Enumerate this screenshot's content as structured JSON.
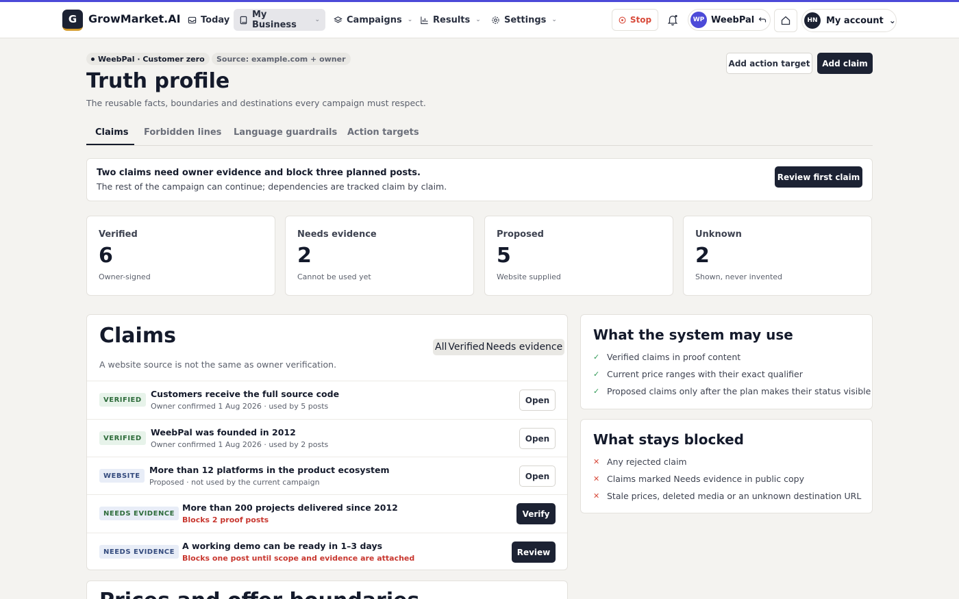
{
  "app": {
    "logo_letter": "G",
    "brand": "GrowMarket.AI"
  },
  "nav": {
    "today": "Today",
    "my_business": "My Business",
    "campaigns": "Campaigns",
    "results": "Results",
    "settings": "Settings"
  },
  "header_actions": {
    "stop": "Stop",
    "workspace_initials": "WP",
    "workspace_name": "WeebPal",
    "account_initials": "HN",
    "account_label": "My account"
  },
  "page": {
    "pill_business": "WeebPal · Customer zero",
    "pill_source": "Source: example.com + owner",
    "title": "Truth profile",
    "subtitle": "The reusable facts, boundaries and destinations every campaign must respect.",
    "add_action_target": "Add action target",
    "add_claim": "Add claim"
  },
  "tabs": [
    "Claims",
    "Forbidden lines",
    "Language guardrails",
    "Action targets"
  ],
  "alert": {
    "title": "Two claims need owner evidence and block three planned posts.",
    "subtitle": "The rest of the campaign can continue; dependencies are tracked claim by claim.",
    "button": "Review first claim"
  },
  "stats": [
    {
      "label": "Verified",
      "value": "6",
      "caption": "Owner-signed"
    },
    {
      "label": "Needs evidence",
      "value": "2",
      "caption": "Cannot be used yet"
    },
    {
      "label": "Proposed",
      "value": "5",
      "caption": "Website supplied"
    },
    {
      "label": "Unknown",
      "value": "2",
      "caption": "Shown, never invented"
    }
  ],
  "claims": {
    "title": "Claims",
    "subtitle": "A website source is not the same as owner verification.",
    "filters": [
      "All",
      "Verified",
      "Needs evidence"
    ],
    "rows": [
      {
        "badge": "VERIFIED",
        "title": "Customers receive the full source code",
        "meta": "Owner confirmed 1 Aug 2026 · used by 5 posts",
        "action": "Open"
      },
      {
        "badge": "VERIFIED",
        "title": "WeebPal was founded in 2012",
        "meta": "Owner confirmed 1 Aug 2026 · used by 2 posts",
        "action": "Open"
      },
      {
        "badge": "WEBSITE",
        "title": "More than 12 platforms in the product ecosystem",
        "meta": "Proposed · not used by the current campaign",
        "action": "Open"
      },
      {
        "badge": "NEEDS EVIDENCE",
        "title": "More than 200 projects delivered since 2012",
        "meta": "Blocks 2 proof posts",
        "action": "Verify"
      },
      {
        "badge": "NEEDS EVIDENCE",
        "title": "A working demo can be ready in 1–3 days",
        "meta": "Blocks one post until scope and evidence are attached",
        "action": "Review"
      }
    ]
  },
  "may_use": {
    "title": "What the system may use",
    "items": [
      "Verified claims in proof content",
      "Current price ranges with their exact qualifier",
      "Proposed claims only after the plan makes their status visible"
    ]
  },
  "blocked": {
    "title": "What stays blocked",
    "items": [
      "Any rejected claim",
      "Claims marked Needs evidence in public copy",
      "Stale prices, deleted media or an unknown destination URL"
    ]
  },
  "next_section": {
    "title": "Prices and offer boundaries"
  },
  "colors": {
    "accent": "#4c4ad8",
    "dark": "#1c2233",
    "danger": "#d84a3a",
    "ok": "#2f9a55"
  }
}
